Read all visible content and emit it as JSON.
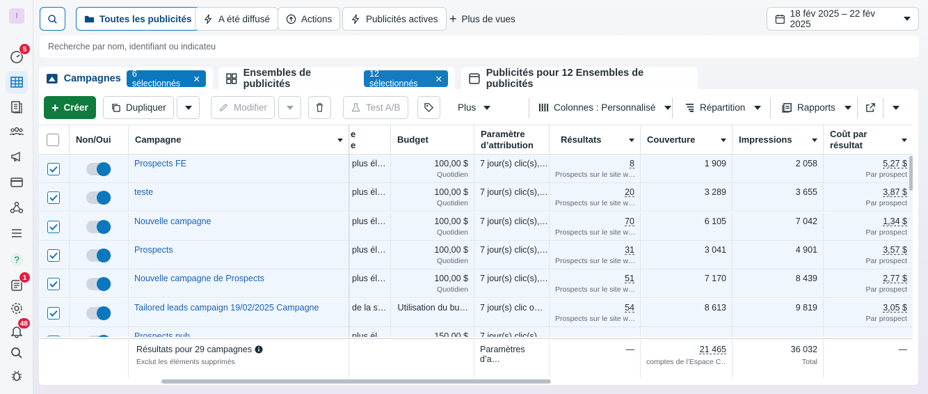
{
  "rail": {
    "avatar_letter": "I",
    "badges": {
      "alerts": "5",
      "updates": "1",
      "notifications": "48"
    }
  },
  "filters": {
    "all_ads": "Toutes les publicités",
    "delivered": "A été diffusé",
    "actions": "Actions",
    "active_ads": "Publicités actives",
    "more_views": "Plus de vues",
    "date_range": "18 fév 2025 – 22 fév 2025"
  },
  "search": {
    "placeholder": "Recherche par nom, identifiant ou indicateu"
  },
  "tabs": {
    "campaigns": {
      "label": "Campagnes",
      "selection": "6 sélectionnés"
    },
    "adsets": {
      "label": "Ensembles de publicités",
      "selection": "12 sélectionnés"
    },
    "ads": {
      "label": "Publicités pour 12 Ensembles de publicités"
    }
  },
  "toolbar": {
    "create": "Créer",
    "duplicate": "Dupliquer",
    "edit": "Modifier",
    "ab_test": "Test A/B",
    "more": "Plus",
    "columns": "Colonnes : Personnalisé",
    "breakdown": "Répartition",
    "reports": "Rapports"
  },
  "columns": {
    "onoff": "Non/Oui",
    "campaign": "Campagne",
    "hidden_fragment_1": "e",
    "hidden_fragment_2": "e",
    "budget": "Budget",
    "attribution_l1": "Paramètre",
    "attribution_l2": "d’attribution",
    "results": "Résultats",
    "reach": "Couverture",
    "impressions": "Impressions",
    "cpr_l1": "Coût par",
    "cpr_l2": "résultat"
  },
  "rows": [
    {
      "name": "Prospects FE",
      "bid": "plus él…",
      "budget": "100,00 $",
      "budget_type": "Quotidien",
      "attribution": "7 jour(s) clic(s),…",
      "results": "8",
      "results_sub": "Prospects sur le site w…",
      "reach": "1 909",
      "impressions": "2 058",
      "cpr": "5,27 $",
      "cpr_sub": "Par prospect"
    },
    {
      "name": "teste",
      "bid": "plus él…",
      "budget": "100,00 $",
      "budget_type": "Quotidien",
      "attribution": "7 jour(s) clic(s),…",
      "results": "20",
      "results_sub": "Prospects sur le site w…",
      "reach": "3 289",
      "impressions": "3 655",
      "cpr": "3,87 $",
      "cpr_sub": "Par prospect"
    },
    {
      "name": "Nouvelle campagne",
      "bid": "plus él…",
      "budget": "100,00 $",
      "budget_type": "Quotidien",
      "attribution": "7 jour(s) clic(s),…",
      "results": "70",
      "results_sub": "Prospects sur le site w…",
      "reach": "6 105",
      "impressions": "7 042",
      "cpr": "1,34 $",
      "cpr_sub": "Par prospect"
    },
    {
      "name": "Prospects",
      "bid": "plus él…",
      "budget": "100,00 $",
      "budget_type": "Quotidien",
      "attribution": "7 jour(s) clic(s),…",
      "results": "31",
      "results_sub": "Prospects sur le site w…",
      "reach": "3 041",
      "impressions": "4 901",
      "cpr": "3,57 $",
      "cpr_sub": "Par prospect"
    },
    {
      "name": "Nouvelle campagne de Prospects",
      "bid": "plus él…",
      "budget": "100,00 $",
      "budget_type": "Quotidien",
      "attribution": "7 jour(s) clic(s),…",
      "results": "51",
      "results_sub": "Prospects sur le site w…",
      "reach": "7 170",
      "impressions": "8 439",
      "cpr": "2,77 $",
      "cpr_sub": "Par prospect"
    },
    {
      "name": "Tailored leads campaign 19/02/2025 Campagne",
      "bid": "de la s…",
      "budget": "Utilisation du bu…",
      "budget_type": "",
      "attribution": "7 jour(s) clic o…",
      "results": "54",
      "results_sub": "Prospects sur le site w…",
      "reach": "8 613",
      "impressions": "9 819",
      "cpr": "3,05 $",
      "cpr_sub": "Par prospect"
    },
    {
      "name": "Prospects pub",
      "bid": "plus él…",
      "budget": "150,00 $",
      "budget_type": "",
      "attribution": "7 jour(s) clic(s),…",
      "results": "",
      "results_sub": "",
      "reach": "",
      "impressions": "",
      "cpr": "",
      "cpr_sub": ""
    }
  ],
  "summary": {
    "label": "Résultats pour 29 campagnes",
    "sub": "Exclut les éléments supprimés",
    "attribution": "Paramètres d’a…",
    "results": "—",
    "reach": "21 465",
    "reach_sub": "comptes de l’Espace C…",
    "impressions": "36 032",
    "impressions_sub": "Total",
    "cpr": "—"
  }
}
